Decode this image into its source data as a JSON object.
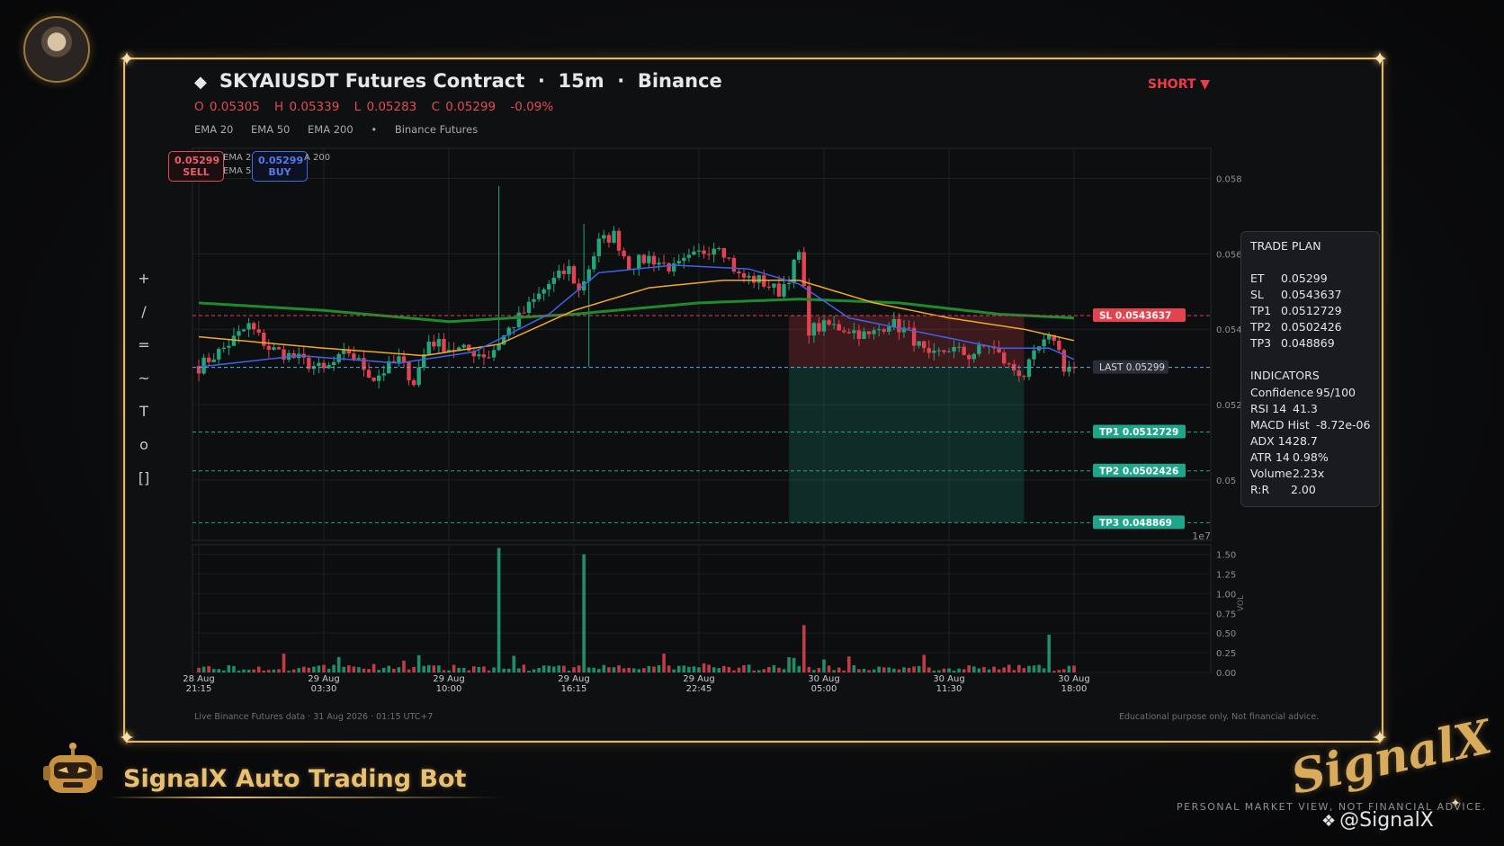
{
  "header": {
    "title": "SKYAIUSDT Futures Contract",
    "timeframe": "15m",
    "exchange": "Binance",
    "separator": "·",
    "ohlc": {
      "open": "O 0.05305",
      "high": "H 0.05339",
      "low": "L 0.05283",
      "close": "C 0.05299",
      "change": "-0.09%"
    },
    "legend": [
      "EMA 20",
      "EMA 50",
      "EMA 200",
      "•",
      "Binance Futures"
    ],
    "direction": "SHORT ▼"
  },
  "toolbar": {
    "tools": [
      "+",
      "/",
      "=",
      "~",
      "T",
      "o",
      "[]"
    ]
  },
  "badges": {
    "sell_price": "0.05299",
    "sell_label": "SELL",
    "buy_price": "0.05299",
    "buy_label": "BUY",
    "ema_legend_overlap": "EMA 2",
    "ema_legend_overlap2": "EMA 5",
    "ema_legend_overlap3": "A 200"
  },
  "trade_plan": {
    "title": "TRADE PLAN",
    "levels": [
      {
        "k": "ET",
        "v": "0.05299"
      },
      {
        "k": "SL",
        "v": "0.0543637"
      },
      {
        "k": "TP1",
        "v": "0.0512729"
      },
      {
        "k": "TP2",
        "v": "0.0502426"
      },
      {
        "k": "TP3",
        "v": "0.048869"
      }
    ],
    "indicators_title": "INDICATORS",
    "indicators": [
      {
        "k": "Confidence",
        "v": "95/100"
      },
      {
        "k": "RSI 14",
        "v": "41.3"
      },
      {
        "k": "MACD Hist",
        "v": "-8.72e-06"
      },
      {
        "k": "ADX 14",
        "v": "28.7"
      },
      {
        "k": "ATR 14",
        "v": "0.98%"
      },
      {
        "k": "Volume",
        "v": "2.23x"
      },
      {
        "k": "R:R",
        "v": "2.00"
      }
    ]
  },
  "level_labels": {
    "sl": "SL  0.0543637",
    "last": "LAST  0.05299",
    "tp1": "TP1  0.0512729",
    "tp2": "TP2  0.0502426",
    "tp3": "TP3  0.048869"
  },
  "footer": {
    "left": "Live Binance Futures data  ·  31 Aug 2026 · 01:15 UTC+7",
    "right": "Educational purpose only. Not financial advice."
  },
  "branding": {
    "bot_name": "SignalX Auto Trading Bot",
    "logo_text": "SignalX",
    "tagline": "PERSONAL MARKET VIEW, NOT FINANCIAL ADVICE.",
    "handle": "@SignalX"
  },
  "colors": {
    "up": "#22a57a",
    "down": "#e2434f",
    "ema20": "#3f63e6",
    "ema50": "#f0a829",
    "ema200": "#1f8a2e",
    "sl": "#e2434f",
    "tp": "#1fa589",
    "last": "#4fb4e6",
    "frame": "#e5b865"
  },
  "chart_data": {
    "type": "candlestick",
    "price_axis": {
      "ticks": [
        0.058,
        0.056,
        0.054,
        0.052,
        0.05
      ],
      "tick_labels": [
        "0.058",
        "0.056",
        "0.054",
        "0.052",
        "0.05"
      ],
      "ylim": [
        0.0484,
        0.0588
      ],
      "exponent_label": "1e7"
    },
    "volume_axis": {
      "ticks": [
        0,
        0.25,
        0.5,
        0.75,
        1.0,
        1.25,
        1.5
      ],
      "tick_labels": [
        "0.00",
        "0.25",
        "0.50",
        "0.75",
        "1.00",
        "1.25",
        "1.50"
      ],
      "ylabel": "VOL"
    },
    "x_ticks": [
      {
        "i": 0,
        "label": [
          "28 Aug",
          "21:15"
        ]
      },
      {
        "i": 25,
        "label": [
          "29 Aug",
          "03:30"
        ]
      },
      {
        "i": 50,
        "label": [
          "29 Aug",
          "10:00"
        ]
      },
      {
        "i": 75,
        "label": [
          "29 Aug",
          "16:15"
        ]
      },
      {
        "i": 100,
        "label": [
          "29 Aug",
          "22:45"
        ]
      },
      {
        "i": 125,
        "label": [
          "30 Aug",
          "05:00"
        ]
      },
      {
        "i": 150,
        "label": [
          "30 Aug",
          "11:30"
        ]
      },
      {
        "i": 175,
        "label": [
          "30 Aug",
          "18:00"
        ]
      }
    ],
    "candle_count": 176,
    "levels": {
      "sl": 0.0543637,
      "entry": 0.05299,
      "tp1": 0.0512729,
      "tp2": 0.0502426,
      "tp3": 0.048869
    },
    "trade_zone_start_index": 118,
    "trade_zone_end_index": 165,
    "close_anchors": [
      [
        0,
        0.053
      ],
      [
        5,
        0.0535
      ],
      [
        10,
        0.0541
      ],
      [
        14,
        0.0535
      ],
      [
        20,
        0.0532
      ],
      [
        25,
        0.0529
      ],
      [
        30,
        0.0534
      ],
      [
        35,
        0.0527
      ],
      [
        40,
        0.0532
      ],
      [
        43,
        0.0526
      ],
      [
        46,
        0.0537
      ],
      [
        50,
        0.0535
      ],
      [
        55,
        0.0534
      ],
      [
        58,
        0.0533
      ],
      [
        62,
        0.054
      ],
      [
        66,
        0.0546
      ],
      [
        70,
        0.0552
      ],
      [
        74,
        0.0556
      ],
      [
        76,
        0.055
      ],
      [
        80,
        0.0563
      ],
      [
        83,
        0.0565
      ],
      [
        86,
        0.0557
      ],
      [
        90,
        0.0559
      ],
      [
        95,
        0.0556
      ],
      [
        100,
        0.056
      ],
      [
        104,
        0.0563
      ],
      [
        108,
        0.0554
      ],
      [
        112,
        0.0553
      ],
      [
        116,
        0.055
      ],
      [
        118,
        0.0554
      ],
      [
        120,
        0.056
      ],
      [
        122,
        0.054
      ],
      [
        126,
        0.0541
      ],
      [
        130,
        0.054
      ],
      [
        134,
        0.0538
      ],
      [
        138,
        0.0542
      ],
      [
        142,
        0.0539
      ],
      [
        146,
        0.0532
      ],
      [
        150,
        0.0535
      ],
      [
        154,
        0.0533
      ],
      [
        158,
        0.0536
      ],
      [
        162,
        0.053
      ],
      [
        165,
        0.0528
      ],
      [
        168,
        0.0535
      ],
      [
        171,
        0.0538
      ],
      [
        173,
        0.053
      ],
      [
        175,
        0.05299
      ]
    ],
    "spikes": [
      {
        "i": 60,
        "high": 0.0578
      },
      {
        "i": 77,
        "high": 0.0568
      },
      {
        "i": 78,
        "low": 0.053
      }
    ],
    "ema20": [
      [
        0,
        0.053
      ],
      [
        20,
        0.0533
      ],
      [
        40,
        0.0531
      ],
      [
        55,
        0.0534
      ],
      [
        70,
        0.0544
      ],
      [
        80,
        0.0555
      ],
      [
        95,
        0.0557
      ],
      [
        110,
        0.0556
      ],
      [
        120,
        0.0552
      ],
      [
        130,
        0.0543
      ],
      [
        145,
        0.0539
      ],
      [
        160,
        0.0535
      ],
      [
        170,
        0.0535
      ],
      [
        175,
        0.0532
      ]
    ],
    "ema50": [
      [
        0,
        0.0538
      ],
      [
        25,
        0.0535
      ],
      [
        45,
        0.0533
      ],
      [
        60,
        0.0536
      ],
      [
        75,
        0.0545
      ],
      [
        90,
        0.0551
      ],
      [
        105,
        0.0553
      ],
      [
        120,
        0.0553
      ],
      [
        135,
        0.0547
      ],
      [
        150,
        0.0543
      ],
      [
        165,
        0.054
      ],
      [
        175,
        0.0537
      ]
    ],
    "ema200": [
      [
        0,
        0.0547
      ],
      [
        25,
        0.0545
      ],
      [
        50,
        0.0542
      ],
      [
        75,
        0.0544
      ],
      [
        100,
        0.0547
      ],
      [
        120,
        0.0548
      ],
      [
        140,
        0.0547
      ],
      [
        160,
        0.0544
      ],
      [
        175,
        0.0543
      ]
    ],
    "volume_spikes": [
      {
        "i": 60,
        "v": 1.58
      },
      {
        "i": 77,
        "v": 1.5
      },
      {
        "i": 121,
        "v": 0.6
      },
      {
        "i": 170,
        "v": 0.48
      }
    ]
  }
}
